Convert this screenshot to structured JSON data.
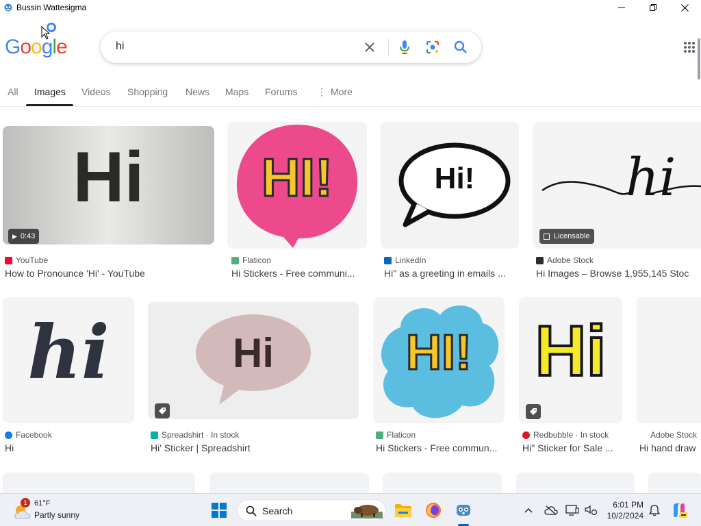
{
  "window": {
    "title": "Bussin Wattesigma"
  },
  "logo": {
    "letters": [
      "G",
      "o",
      "o",
      "g",
      "l",
      "e"
    ]
  },
  "search": {
    "query": "hi"
  },
  "tabs": [
    {
      "label": "All"
    },
    {
      "label": "Images"
    },
    {
      "label": "Videos"
    },
    {
      "label": "Shopping"
    },
    {
      "label": "News"
    },
    {
      "label": "Maps"
    },
    {
      "label": "Forums"
    },
    {
      "label": "More"
    }
  ],
  "active_tab": "Images",
  "results": [
    {
      "source": "YouTube",
      "title": "How to Pronounce 'Hi' - YouTube",
      "thumb_text": "Hi",
      "badge": "0:43"
    },
    {
      "source": "Flaticon",
      "title": "Hi Stickers - Free communi...",
      "thumb_text": "HI!"
    },
    {
      "source": "LinkedIn",
      "title": "Hi\" as a greeting in emails ...",
      "thumb_text": "Hi!"
    },
    {
      "source": "Adobe Stock",
      "title": "Hi Images – Browse 1,955,145 Stoc",
      "thumb_text": "hi",
      "badge": "Licensable"
    },
    {
      "source": "Facebook",
      "title": "Hi",
      "thumb_text": "hi"
    },
    {
      "source": "Spreadshirt · In stock",
      "title": "Hi' Sticker | Spreadshirt",
      "thumb_text": "Hi"
    },
    {
      "source": "Flaticon",
      "title": "Hi Stickers - Free commun...",
      "thumb_text": "HI!"
    },
    {
      "source": "Redbubble · In stock",
      "title": "Hi\" Sticker for Sale ...",
      "thumb_text": "Hi"
    },
    {
      "source": "Adobe Stock",
      "title": "Hi hand draw"
    }
  ],
  "taskbar": {
    "weather": {
      "temp": "61°F",
      "condition": "Partly sunny",
      "alert_count": "1"
    },
    "search_label": "Search",
    "time": "6:01 PM",
    "date": "10/2/2024"
  },
  "colors": {
    "youtube": "#ff0033",
    "flaticon": "#4caf7d",
    "linkedin": "#0a66c2",
    "adobe": "#2c2c2c",
    "facebook": "#1877f2",
    "spreadshirt": "#00b2a5",
    "redbubble": "#e41321"
  }
}
